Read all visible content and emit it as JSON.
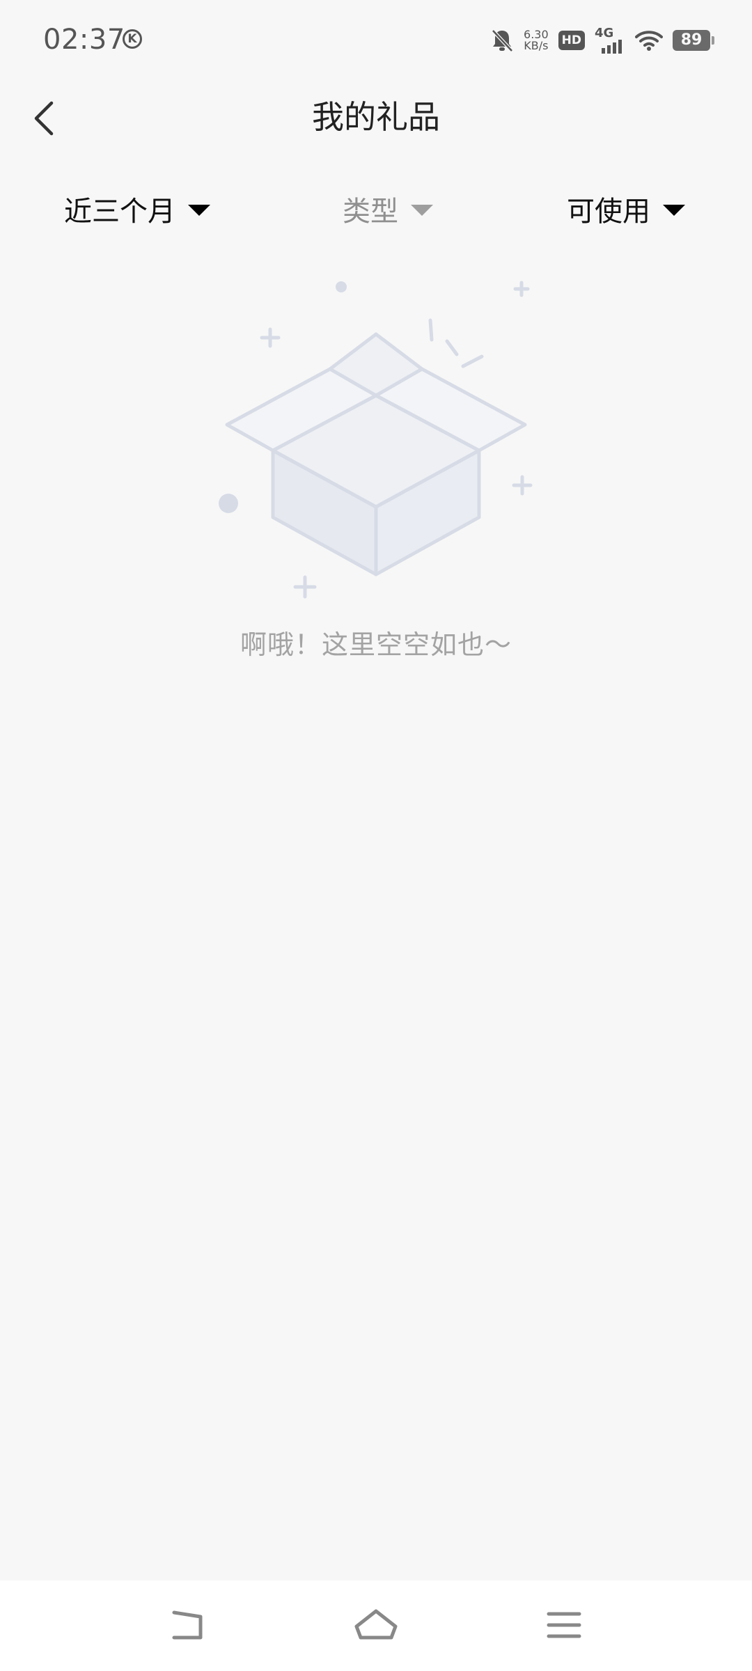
{
  "status_bar": {
    "time": "02:37",
    "carrier_badge": "K",
    "speed_value": "6.30",
    "speed_unit": "KB/s",
    "hd_label": "HD",
    "network_label": "4G",
    "battery_level": "89"
  },
  "header": {
    "title": "我的礼品"
  },
  "filters": {
    "time_range": "近三个月",
    "type": "类型",
    "status": "可使用"
  },
  "empty_state": {
    "message": "啊哦！这里空空如也～"
  },
  "colors": {
    "background": "#f7f7f7",
    "illustration": "#dde1ea",
    "empty_text": "#a3a3a3",
    "disabled_filter": "#8f8f8f"
  }
}
